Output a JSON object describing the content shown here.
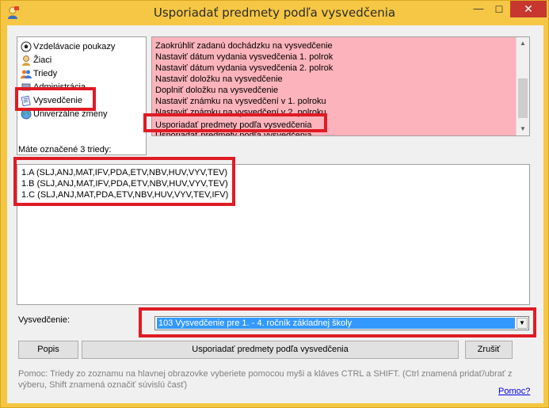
{
  "window": {
    "title": "Usporiadať predmety podľa vysvedčenia",
    "close_label": "✕",
    "minimize_label": "—",
    "maximize_label": "☐"
  },
  "tree": {
    "items": [
      {
        "label": "Vzdelávacie poukazy",
        "icon": "soccer-ball-icon"
      },
      {
        "label": "Žiaci",
        "icon": "student-icon"
      },
      {
        "label": "Triedy",
        "icon": "class-group-icon"
      },
      {
        "label": "Administrácia",
        "icon": "admin-icon"
      },
      {
        "label": "Vysvedčenie",
        "icon": "certificate-icon"
      },
      {
        "label": "Univerzálne zmeny",
        "icon": "globe-icon"
      }
    ]
  },
  "actions": {
    "items": [
      "Zaokrúhliť zadanú dochádzku na vysvedčenie",
      "Nastaviť dátum vydania vysvedčenia 1. polrok",
      "Nastaviť dátum vydania vysvedčenia 2. polrok",
      "Nastaviť doložku na vysvedčenie",
      "Doplniť doložku na vysvedčenie",
      "Nastaviť známku na vysvedčení v 1. polroku",
      "Nastaviť známku na vysvedčení v 2. polroku",
      "Usporiadať predmety podľa vysvedčenia",
      "Usporiadať predmety podľa vysvedčenia"
    ]
  },
  "marked": {
    "label": "Máte označené 3 triedy:",
    "lines": [
      "1.A (SLJ,ANJ,MAT,IFV,PDA,ETV,NBV,HUV,VYV,TEV)",
      "1.B (SLJ,ANJ,MAT,IFV,PDA,ETV,NBV,HUV,VYV,TEV)",
      "1.C (SLJ,ANJ,MAT,PDA,ETV,NBV,HUV,VYV,TEV,IFV)"
    ]
  },
  "certificate": {
    "label": "Vysvedčenie:",
    "selected": "103 Vysvedčenie pre 1. - 4. ročník základnej školy"
  },
  "buttons": {
    "popis": "Popis",
    "sort": "Usporiadať predmety podľa vysvedčenia",
    "cancel": "Zrušiť"
  },
  "help": {
    "text": "Pomoc: Triedy zo zoznamu na hlavnej obrazovke vyberiete pomocou myši a kláves CTRL a SHIFT. (Ctrl znamená pridať/ubrať z výberu, Shift znamená označiť súvislú časť)",
    "link": "Pomoc?"
  },
  "colors": {
    "titlebar": "#f6c744",
    "list_background": "#fcb3bb",
    "highlight": "#e01b24",
    "selection": "#3399ff"
  }
}
